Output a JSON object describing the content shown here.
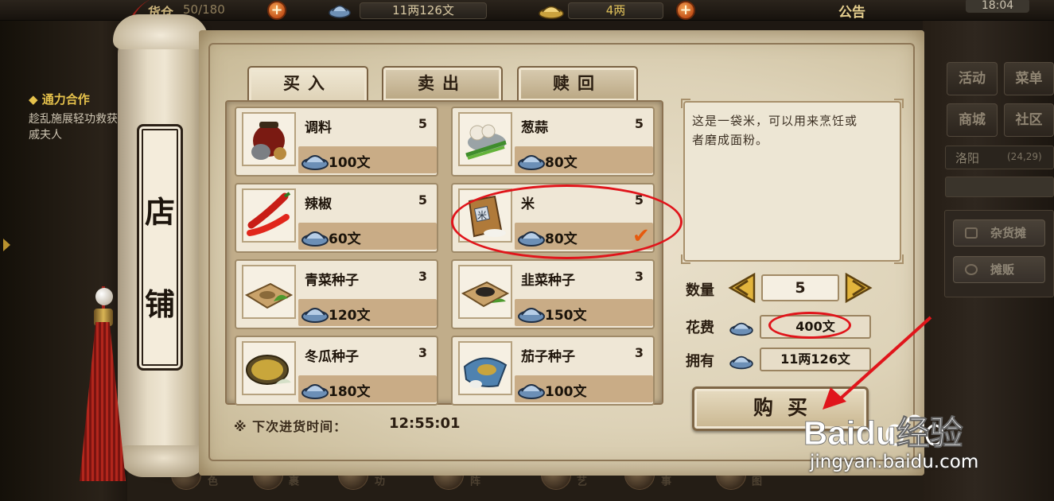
{
  "topbar": {
    "bag_label": "货仓",
    "bag_value": "50/180",
    "silver_value": "11两126文",
    "gold_value": "4两",
    "notice": "公告",
    "clock": "18:04"
  },
  "quest": {
    "title": "◆ 通力合作",
    "desc": "趁乱施展轻功救获戚夫人"
  },
  "scroll_title": [
    "店",
    "铺"
  ],
  "tabs": [
    {
      "label": "买入",
      "active": true
    },
    {
      "label": "卖出",
      "active": false
    },
    {
      "label": "赎回",
      "active": false
    }
  ],
  "items": [
    {
      "name": "调料",
      "stock": "5",
      "price": "100文",
      "icon": "seasoning-jars-icon"
    },
    {
      "name": "葱蒜",
      "stock": "5",
      "price": "80文",
      "icon": "scallion-garlic-icon"
    },
    {
      "name": "辣椒",
      "stock": "5",
      "price": "60文",
      "icon": "chili-pepper-icon"
    },
    {
      "name": "米",
      "stock": "5",
      "price": "80文",
      "icon": "rice-sack-icon",
      "selected": true
    },
    {
      "name": "青菜种子",
      "stock": "3",
      "price": "120文",
      "icon": "greens-seed-icon"
    },
    {
      "name": "韭菜种子",
      "stock": "3",
      "price": "150文",
      "icon": "chive-seed-icon"
    },
    {
      "name": "冬瓜种子",
      "stock": "3",
      "price": "180文",
      "icon": "wax-gourd-seed-icon"
    },
    {
      "name": "茄子种子",
      "stock": "3",
      "price": "100文",
      "icon": "eggplant-seed-icon"
    }
  ],
  "restock": {
    "label": "※ 下次进货时间：",
    "time": "12:55:01"
  },
  "description": "这是一袋米，可以用来烹饪或者磨成面粉。",
  "purchase": {
    "qty_label": "数量",
    "qty_value": "5",
    "cost_label": "花费",
    "cost_value": "400文",
    "owned_label": "拥有",
    "owned_value": "11两126文",
    "buy_label": "购买"
  },
  "right_menu": {
    "activity": "活动",
    "menu": "菜单",
    "mall": "商城",
    "community": "社区",
    "city": "洛阳",
    "coords": "(24,29)",
    "stall_general": "杂货摊",
    "stall_vendor": "摊贩"
  },
  "bottom_nav": [
    "角色",
    "包裹",
    "武功",
    "布阵",
    "技艺",
    "记事",
    "地图"
  ],
  "watermark": {
    "brand_text": "Baidu经验",
    "url": "jingyan.baidu.com"
  },
  "colors": {
    "annotation_red": "#e0151b",
    "parchment": "#e9e0cb",
    "card_price_bar": "#c9ac86",
    "plus_orange": "#e07a2c"
  }
}
